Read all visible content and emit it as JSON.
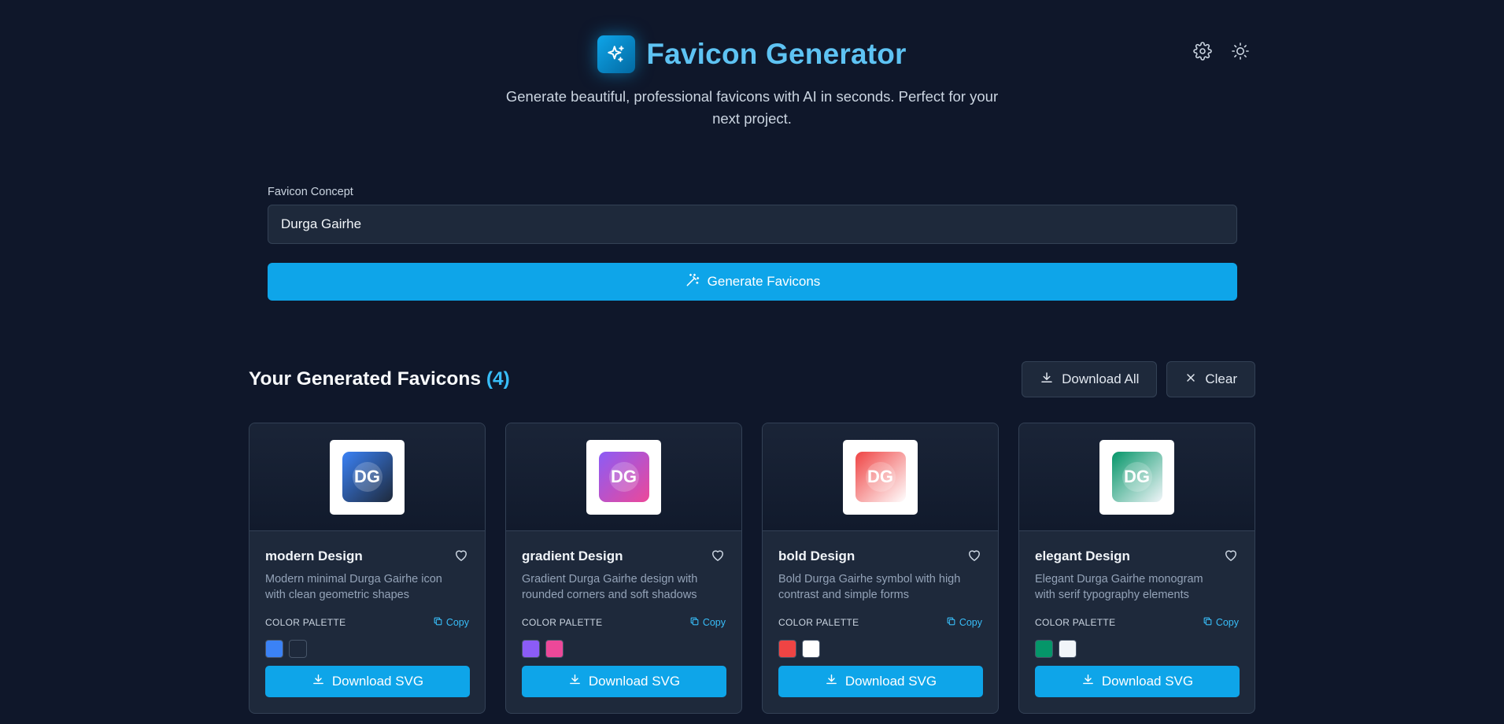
{
  "header": {
    "title": "Favicon Generator",
    "subtitle_line1": "Generate beautiful, professional favicons with AI in seconds. Perfect for your",
    "subtitle_line2": "next project.",
    "logo_icon": "sparkles-icon",
    "settings_icon": "gear-icon",
    "theme_icon": "sun-icon"
  },
  "form": {
    "label": "Favicon Concept",
    "value": "Durga Gairhe",
    "generate_label": "Generate Favicons",
    "generate_icon": "magic-wand-icon"
  },
  "results": {
    "title": "Your Generated Favicons",
    "count": "(4)",
    "download_all_label": "Download All",
    "clear_label": "Clear"
  },
  "cards": [
    {
      "initials": "DG",
      "title": "modern Design",
      "desc_line1": "Modern minimal Durga Gairhe icon",
      "desc_line2": "with clean geometric shapes",
      "palette_label": "COLOR PALETTE",
      "copy_label": "Copy",
      "download_label": "Download SVG",
      "gradient": [
        "#3b82f6",
        "#1e293b"
      ],
      "swatches": [
        "#3b82f6",
        "#1e293b"
      ]
    },
    {
      "initials": "DG",
      "title": "gradient Design",
      "desc_line1": "Gradient Durga Gairhe design with",
      "desc_line2": "rounded corners and soft shadows",
      "palette_label": "COLOR PALETTE",
      "copy_label": "Copy",
      "download_label": "Download SVG",
      "gradient": [
        "#8b5cf6",
        "#ec4899"
      ],
      "swatches": [
        "#8b5cf6",
        "#ec4899"
      ]
    },
    {
      "initials": "DG",
      "title": "bold Design",
      "desc_line1": "Bold Durga Gairhe symbol with high",
      "desc_line2": "contrast and simple forms",
      "palette_label": "COLOR PALETTE",
      "copy_label": "Copy",
      "download_label": "Download SVG",
      "gradient": [
        "#ef4444",
        "#ffffff"
      ],
      "swatches": [
        "#ef4444",
        "#ffffff"
      ]
    },
    {
      "initials": "DG",
      "title": "elegant Design",
      "desc_line1": "Elegant Durga Gairhe monogram",
      "desc_line2": "with serif typography elements",
      "palette_label": "COLOR PALETTE",
      "copy_label": "Copy",
      "download_label": "Download SVG",
      "gradient": [
        "#059669",
        "#f1f5f9"
      ],
      "swatches": [
        "#059669",
        "#f1f5f9"
      ]
    }
  ]
}
